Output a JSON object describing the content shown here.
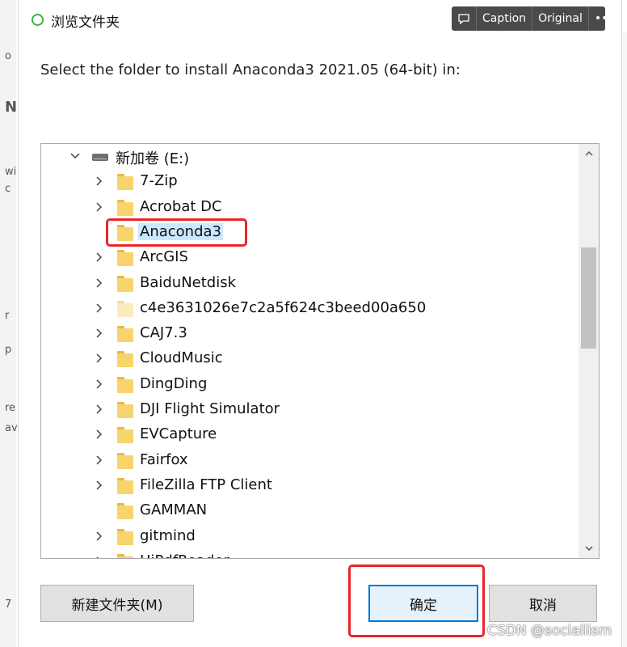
{
  "dialog": {
    "title": "浏览文件夹",
    "instruction": "Select the folder to install Anaconda3 2021.05 (64-bit) in:"
  },
  "overlay": {
    "caption": "Caption",
    "original": "Original",
    "more": "•••"
  },
  "tree": {
    "drive": "新加卷 (E:)",
    "folders": [
      {
        "name": "7-Zip",
        "expandable": true
      },
      {
        "name": "Acrobat DC",
        "expandable": true
      },
      {
        "name": "Anaconda3",
        "expandable": false,
        "selected": true
      },
      {
        "name": "ArcGIS",
        "expandable": true
      },
      {
        "name": "BaiduNetdisk",
        "expandable": true
      },
      {
        "name": "c4e3631026e7c2a5f624c3beed00a650",
        "expandable": true,
        "pale": true
      },
      {
        "name": "CAJ7.3",
        "expandable": true
      },
      {
        "name": "CloudMusic",
        "expandable": true
      },
      {
        "name": "DingDing",
        "expandable": true
      },
      {
        "name": "DJI Flight Simulator",
        "expandable": true
      },
      {
        "name": "EVCapture",
        "expandable": true
      },
      {
        "name": "Fairfox",
        "expandable": true
      },
      {
        "name": "FileZilla FTP Client",
        "expandable": true
      },
      {
        "name": "GAMMAN",
        "expandable": false
      },
      {
        "name": "gitmind",
        "expandable": true
      },
      {
        "name": "HiPdfReader",
        "expandable": true
      }
    ]
  },
  "buttons": {
    "new_folder": "新建文件夹(M)",
    "ok": "确定",
    "cancel": "取消"
  },
  "watermark": "CSDN @sociallism",
  "background_fragments": [
    "o",
    "N",
    "wi",
    "c",
    "r",
    "p",
    "re",
    "av",
    "7"
  ],
  "colors": {
    "accent": "#0078d7",
    "annotation": "#e8262a",
    "selection": "#cce8ff",
    "folder": "#f7d46c"
  }
}
